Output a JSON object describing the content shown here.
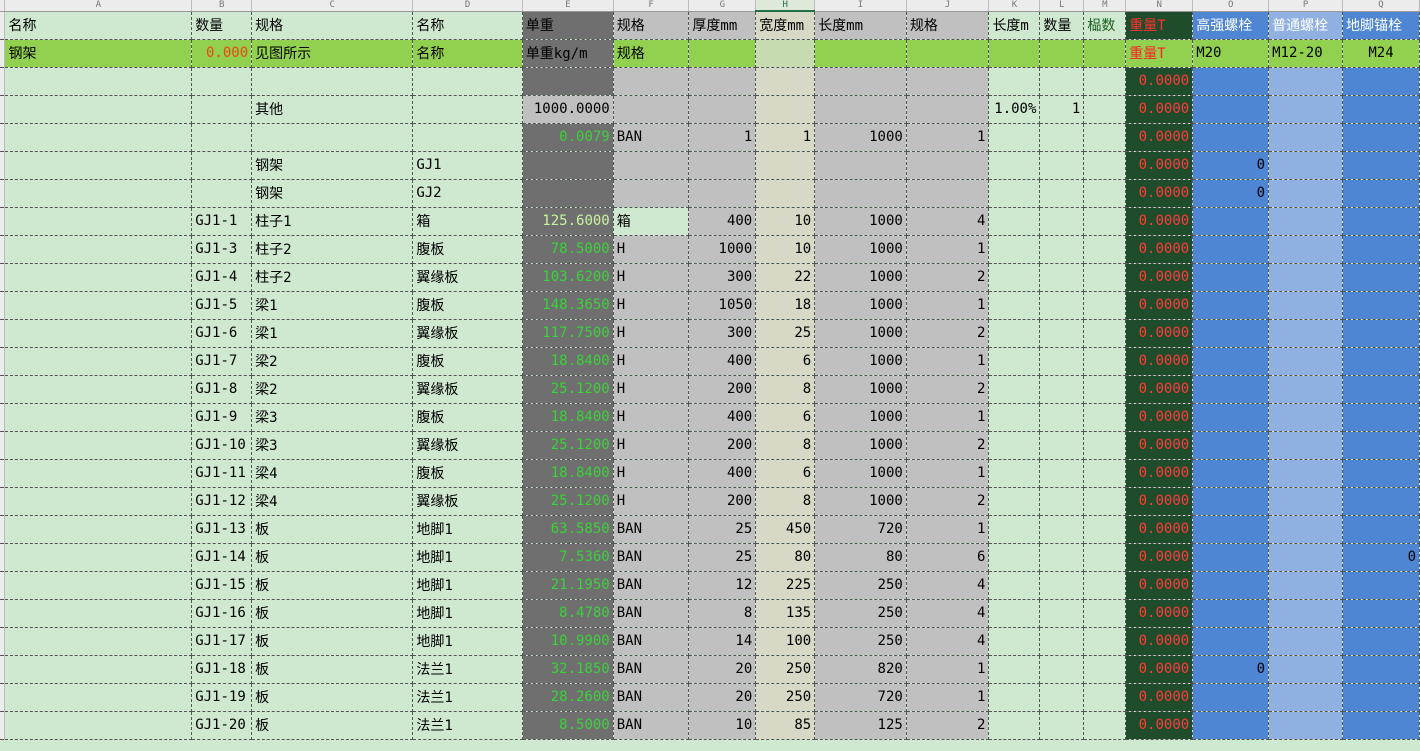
{
  "columns": [
    "A",
    "B",
    "C",
    "D",
    "E",
    "F",
    "G",
    "H",
    "I",
    "J",
    "K",
    "L",
    "M",
    "N",
    "O",
    "P",
    "Q"
  ],
  "selected_column": "H",
  "header1": {
    "A": "名称",
    "B": "数量",
    "C": "规格",
    "D": "名称",
    "E": "单重",
    "F": "规格",
    "G": "厚度mm",
    "H": "宽度mm",
    "I": "长度mm",
    "J": "规格",
    "K": "长度m",
    "L": "数量",
    "M": "榀数",
    "N": "重量T",
    "O": "高强螺栓",
    "P": "普通螺栓",
    "Q": "地脚锚栓"
  },
  "header2": {
    "A": "钢架",
    "B": "0.000",
    "C": "见图所示",
    "D": "名称",
    "E": "单重kg/m",
    "F": "规格",
    "G": "",
    "H": "",
    "I": "",
    "J": "",
    "K": "",
    "L": "",
    "M": "",
    "N": "重量T",
    "O": "M20",
    "P": "M12-20",
    "Q": "M24"
  },
  "rows": [
    {
      "A": "",
      "B": "",
      "C": "",
      "D": "",
      "E": "",
      "F": "",
      "G": "",
      "H": "",
      "I": "",
      "J": "",
      "K": "",
      "L": "",
      "M": "",
      "N": "0.0000",
      "O": "",
      "P": "",
      "Q": ""
    },
    {
      "A": "",
      "B": "",
      "C": "其他",
      "D": "",
      "E": "1000.0000",
      "F": "",
      "G": "",
      "H": "",
      "I": "",
      "J": "",
      "K": "1.00%",
      "L": "1",
      "M": "",
      "N": "0.0000",
      "O": "",
      "P": "",
      "Q": ""
    },
    {
      "A": "",
      "B": "",
      "C": "",
      "D": "",
      "E": "0.0079",
      "F": "BAN",
      "G": "1",
      "H": "1",
      "I": "1000",
      "J": "1",
      "K": "",
      "L": "",
      "M": "",
      "N": "0.0000",
      "O": "",
      "P": "",
      "Q": ""
    },
    {
      "A": "",
      "B": "",
      "C": "钢架",
      "D": "GJ1",
      "E": "",
      "F": "",
      "G": "",
      "H": "",
      "I": "",
      "J": "",
      "K": "",
      "L": "",
      "M": "",
      "N": "0.0000",
      "O": "0",
      "P": "",
      "Q": ""
    },
    {
      "A": "",
      "B": "",
      "C": "钢架",
      "D": "GJ2",
      "E": "",
      "F": "",
      "G": "",
      "H": "",
      "I": "",
      "J": "",
      "K": "",
      "L": "",
      "M": "",
      "N": "0.0000",
      "O": "0",
      "P": "",
      "Q": ""
    },
    {
      "A": "",
      "B": "GJ1-1",
      "C": "柱子1",
      "D": "箱",
      "E": "125.6000",
      "F": "箱",
      "G": "400",
      "H": "10",
      "I": "1000",
      "J": "4",
      "K": "",
      "L": "",
      "M": "",
      "N": "0.0000",
      "O": "",
      "P": "",
      "Q": ""
    },
    {
      "A": "",
      "B": "GJ1-3",
      "C": "柱子2",
      "D": "腹板",
      "E": "78.5000",
      "F": "H",
      "G": "1000",
      "H": "10",
      "I": "1000",
      "J": "1",
      "K": "",
      "L": "",
      "M": "",
      "N": "0.0000",
      "O": "",
      "P": "",
      "Q": ""
    },
    {
      "A": "",
      "B": "GJ1-4",
      "C": "柱子2",
      "D": "翼缘板",
      "E": "103.6200",
      "F": "H",
      "G": "300",
      "H": "22",
      "I": "1000",
      "J": "2",
      "K": "",
      "L": "",
      "M": "",
      "N": "0.0000",
      "O": "",
      "P": "",
      "Q": ""
    },
    {
      "A": "",
      "B": "GJ1-5",
      "C": "梁1",
      "D": "腹板",
      "E": "148.3650",
      "F": "H",
      "G": "1050",
      "H": "18",
      "I": "1000",
      "J": "1",
      "K": "",
      "L": "",
      "M": "",
      "N": "0.0000",
      "O": "",
      "P": "",
      "Q": ""
    },
    {
      "A": "",
      "B": "GJ1-6",
      "C": "梁1",
      "D": "翼缘板",
      "E": "117.7500",
      "F": "H",
      "G": "300",
      "H": "25",
      "I": "1000",
      "J": "2",
      "K": "",
      "L": "",
      "M": "",
      "N": "0.0000",
      "O": "",
      "P": "",
      "Q": ""
    },
    {
      "A": "",
      "B": "GJ1-7",
      "C": "梁2",
      "D": "腹板",
      "E": "18.8400",
      "F": "H",
      "G": "400",
      "H": "6",
      "I": "1000",
      "J": "1",
      "K": "",
      "L": "",
      "M": "",
      "N": "0.0000",
      "O": "",
      "P": "",
      "Q": ""
    },
    {
      "A": "",
      "B": "GJ1-8",
      "C": "梁2",
      "D": "翼缘板",
      "E": "25.1200",
      "F": "H",
      "G": "200",
      "H": "8",
      "I": "1000",
      "J": "2",
      "K": "",
      "L": "",
      "M": "",
      "N": "0.0000",
      "O": "",
      "P": "",
      "Q": ""
    },
    {
      "A": "",
      "B": "GJ1-9",
      "C": "梁3",
      "D": "腹板",
      "E": "18.8400",
      "F": "H",
      "G": "400",
      "H": "6",
      "I": "1000",
      "J": "1",
      "K": "",
      "L": "",
      "M": "",
      "N": "0.0000",
      "O": "",
      "P": "",
      "Q": ""
    },
    {
      "A": "",
      "B": "GJ1-10",
      "C": "梁3",
      "D": "翼缘板",
      "E": "25.1200",
      "F": "H",
      "G": "200",
      "H": "8",
      "I": "1000",
      "J": "2",
      "K": "",
      "L": "",
      "M": "",
      "N": "0.0000",
      "O": "",
      "P": "",
      "Q": ""
    },
    {
      "A": "",
      "B": "GJ1-11",
      "C": "梁4",
      "D": "腹板",
      "E": "18.8400",
      "F": "H",
      "G": "400",
      "H": "6",
      "I": "1000",
      "J": "1",
      "K": "",
      "L": "",
      "M": "",
      "N": "0.0000",
      "O": "",
      "P": "",
      "Q": ""
    },
    {
      "A": "",
      "B": "GJ1-12",
      "C": "梁4",
      "D": "翼缘板",
      "E": "25.1200",
      "F": "H",
      "G": "200",
      "H": "8",
      "I": "1000",
      "J": "2",
      "K": "",
      "L": "",
      "M": "",
      "N": "0.0000",
      "O": "",
      "P": "",
      "Q": ""
    },
    {
      "A": "",
      "B": "GJ1-13",
      "C": "板",
      "D": "地脚1",
      "E": "63.5850",
      "F": "BAN",
      "G": "25",
      "H": "450",
      "I": "720",
      "J": "1",
      "K": "",
      "L": "",
      "M": "",
      "N": "0.0000",
      "O": "",
      "P": "",
      "Q": ""
    },
    {
      "A": "",
      "B": "GJ1-14",
      "C": "板",
      "D": "地脚1",
      "E": "7.5360",
      "F": "BAN",
      "G": "25",
      "H": "80",
      "I": "80",
      "J": "6",
      "K": "",
      "L": "",
      "M": "",
      "N": "0.0000",
      "O": "",
      "P": "",
      "Q": "0"
    },
    {
      "A": "",
      "B": "GJ1-15",
      "C": "板",
      "D": "地脚1",
      "E": "21.1950",
      "F": "BAN",
      "G": "12",
      "H": "225",
      "I": "250",
      "J": "4",
      "K": "",
      "L": "",
      "M": "",
      "N": "0.0000",
      "O": "",
      "P": "",
      "Q": ""
    },
    {
      "A": "",
      "B": "GJ1-16",
      "C": "板",
      "D": "地脚1",
      "E": "8.4780",
      "F": "BAN",
      "G": "8",
      "H": "135",
      "I": "250",
      "J": "4",
      "K": "",
      "L": "",
      "M": "",
      "N": "0.0000",
      "O": "",
      "P": "",
      "Q": ""
    },
    {
      "A": "",
      "B": "GJ1-17",
      "C": "板",
      "D": "地脚1",
      "E": "10.9900",
      "F": "BAN",
      "G": "14",
      "H": "100",
      "I": "250",
      "J": "4",
      "K": "",
      "L": "",
      "M": "",
      "N": "0.0000",
      "O": "",
      "P": "",
      "Q": ""
    },
    {
      "A": "",
      "B": "GJ1-18",
      "C": "板",
      "D": "法兰1",
      "E": "32.1850",
      "F": "BAN",
      "G": "20",
      "H": "250",
      "I": "820",
      "J": "1",
      "K": "",
      "L": "",
      "M": "",
      "N": "0.0000",
      "O": "0",
      "P": "",
      "Q": ""
    },
    {
      "A": "",
      "B": "GJ1-19",
      "C": "板",
      "D": "法兰1",
      "E": "28.2600",
      "F": "BAN",
      "G": "20",
      "H": "250",
      "I": "720",
      "J": "1",
      "K": "",
      "L": "",
      "M": "",
      "N": "0.0000",
      "O": "",
      "P": "",
      "Q": ""
    },
    {
      "A": "",
      "B": "GJ1-20",
      "C": "板",
      "D": "法兰1",
      "E": "8.5000",
      "F": "BAN",
      "G": "10",
      "H": "85",
      "I": "125",
      "J": "2",
      "K": "",
      "L": "",
      "M": "",
      "N": "0.0000",
      "O": "",
      "P": "",
      "Q": ""
    }
  ],
  "colors": {
    "weight_green": "#3ad23a",
    "weight_red": "#ff2020",
    "header_green": "#92d050",
    "bolt_blue": "#4f86d4",
    "selected_column_green": "#217346"
  }
}
